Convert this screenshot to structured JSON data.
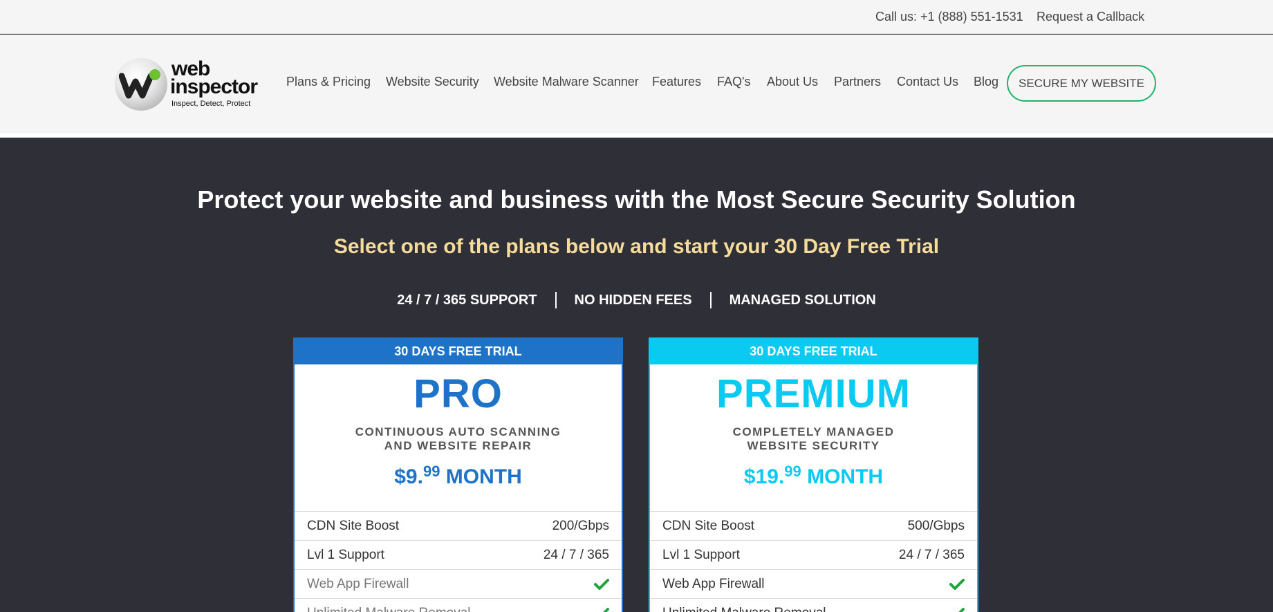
{
  "topbar": {
    "call": "Call us: +1 (888) 551-1531",
    "callback": "Request a Callback"
  },
  "logo": {
    "line1": "web",
    "line2": "inspector",
    "tagline": "Inspect, Detect, Protect"
  },
  "nav": {
    "items": [
      {
        "label": "Plans & Pricing"
      },
      {
        "label": "Website Security"
      },
      {
        "label": "Website Malware Scanner"
      },
      {
        "label": "Features"
      },
      {
        "label": "FAQ's"
      },
      {
        "label": "About Us"
      },
      {
        "label": "Partners"
      },
      {
        "label": "Contact Us"
      },
      {
        "label": "Blog"
      }
    ],
    "cta": "SECURE MY WEBSITE"
  },
  "hero": {
    "title": "Protect your website and business with the Most Secure Security Solution",
    "subtitle": "Select one of the plans below and start your 30 Day Free Trial",
    "benefits": [
      "24 / 7 / 365 SUPPORT",
      "NO HIDDEN FEES",
      "MANAGED SOLUTION"
    ]
  },
  "plans": [
    {
      "ribbon": "30 DAYS FREE TRIAL",
      "name": "PRO",
      "desc1": "CONTINUOUS AUTO SCANNING",
      "desc2": "AND WEBSITE REPAIR",
      "price_main": "$9.",
      "price_cents": "99",
      "price_period": "MONTH",
      "features": [
        {
          "label": "CDN Site Boost",
          "value": "200/Gbps"
        },
        {
          "label": "Lvl 1 Support",
          "value": "24 / 7 / 365"
        },
        {
          "label": "Web App Firewall",
          "value": ""
        },
        {
          "label": "Unlimited Malware Removal",
          "value": ""
        }
      ]
    },
    {
      "ribbon": "30 DAYS FREE TRIAL",
      "name": "PREMIUM",
      "desc1": "COMPLETELY MANAGED",
      "desc2": "WEBSITE SECURITY",
      "price_main": "$19.",
      "price_cents": "99",
      "price_period": "MONTH",
      "features": [
        {
          "label": "CDN Site Boost",
          "value": "500/Gbps"
        },
        {
          "label": "Lvl 1 Support",
          "value": "24 / 7 / 365"
        },
        {
          "label": "Web App Firewall",
          "value": ""
        },
        {
          "label": "Unlimited Malware Removal",
          "value": ""
        }
      ]
    }
  ],
  "colors": {
    "pro": "#1e73c8",
    "premium": "#0bcaf2",
    "hero_bg": "#2f2f38",
    "subtitle": "#f6dc9a",
    "cta_border": "#21b36a",
    "check": "#1fa33a"
  },
  "icons": {
    "check": "check-icon",
    "logo": "web-inspector-logo-icon"
  }
}
